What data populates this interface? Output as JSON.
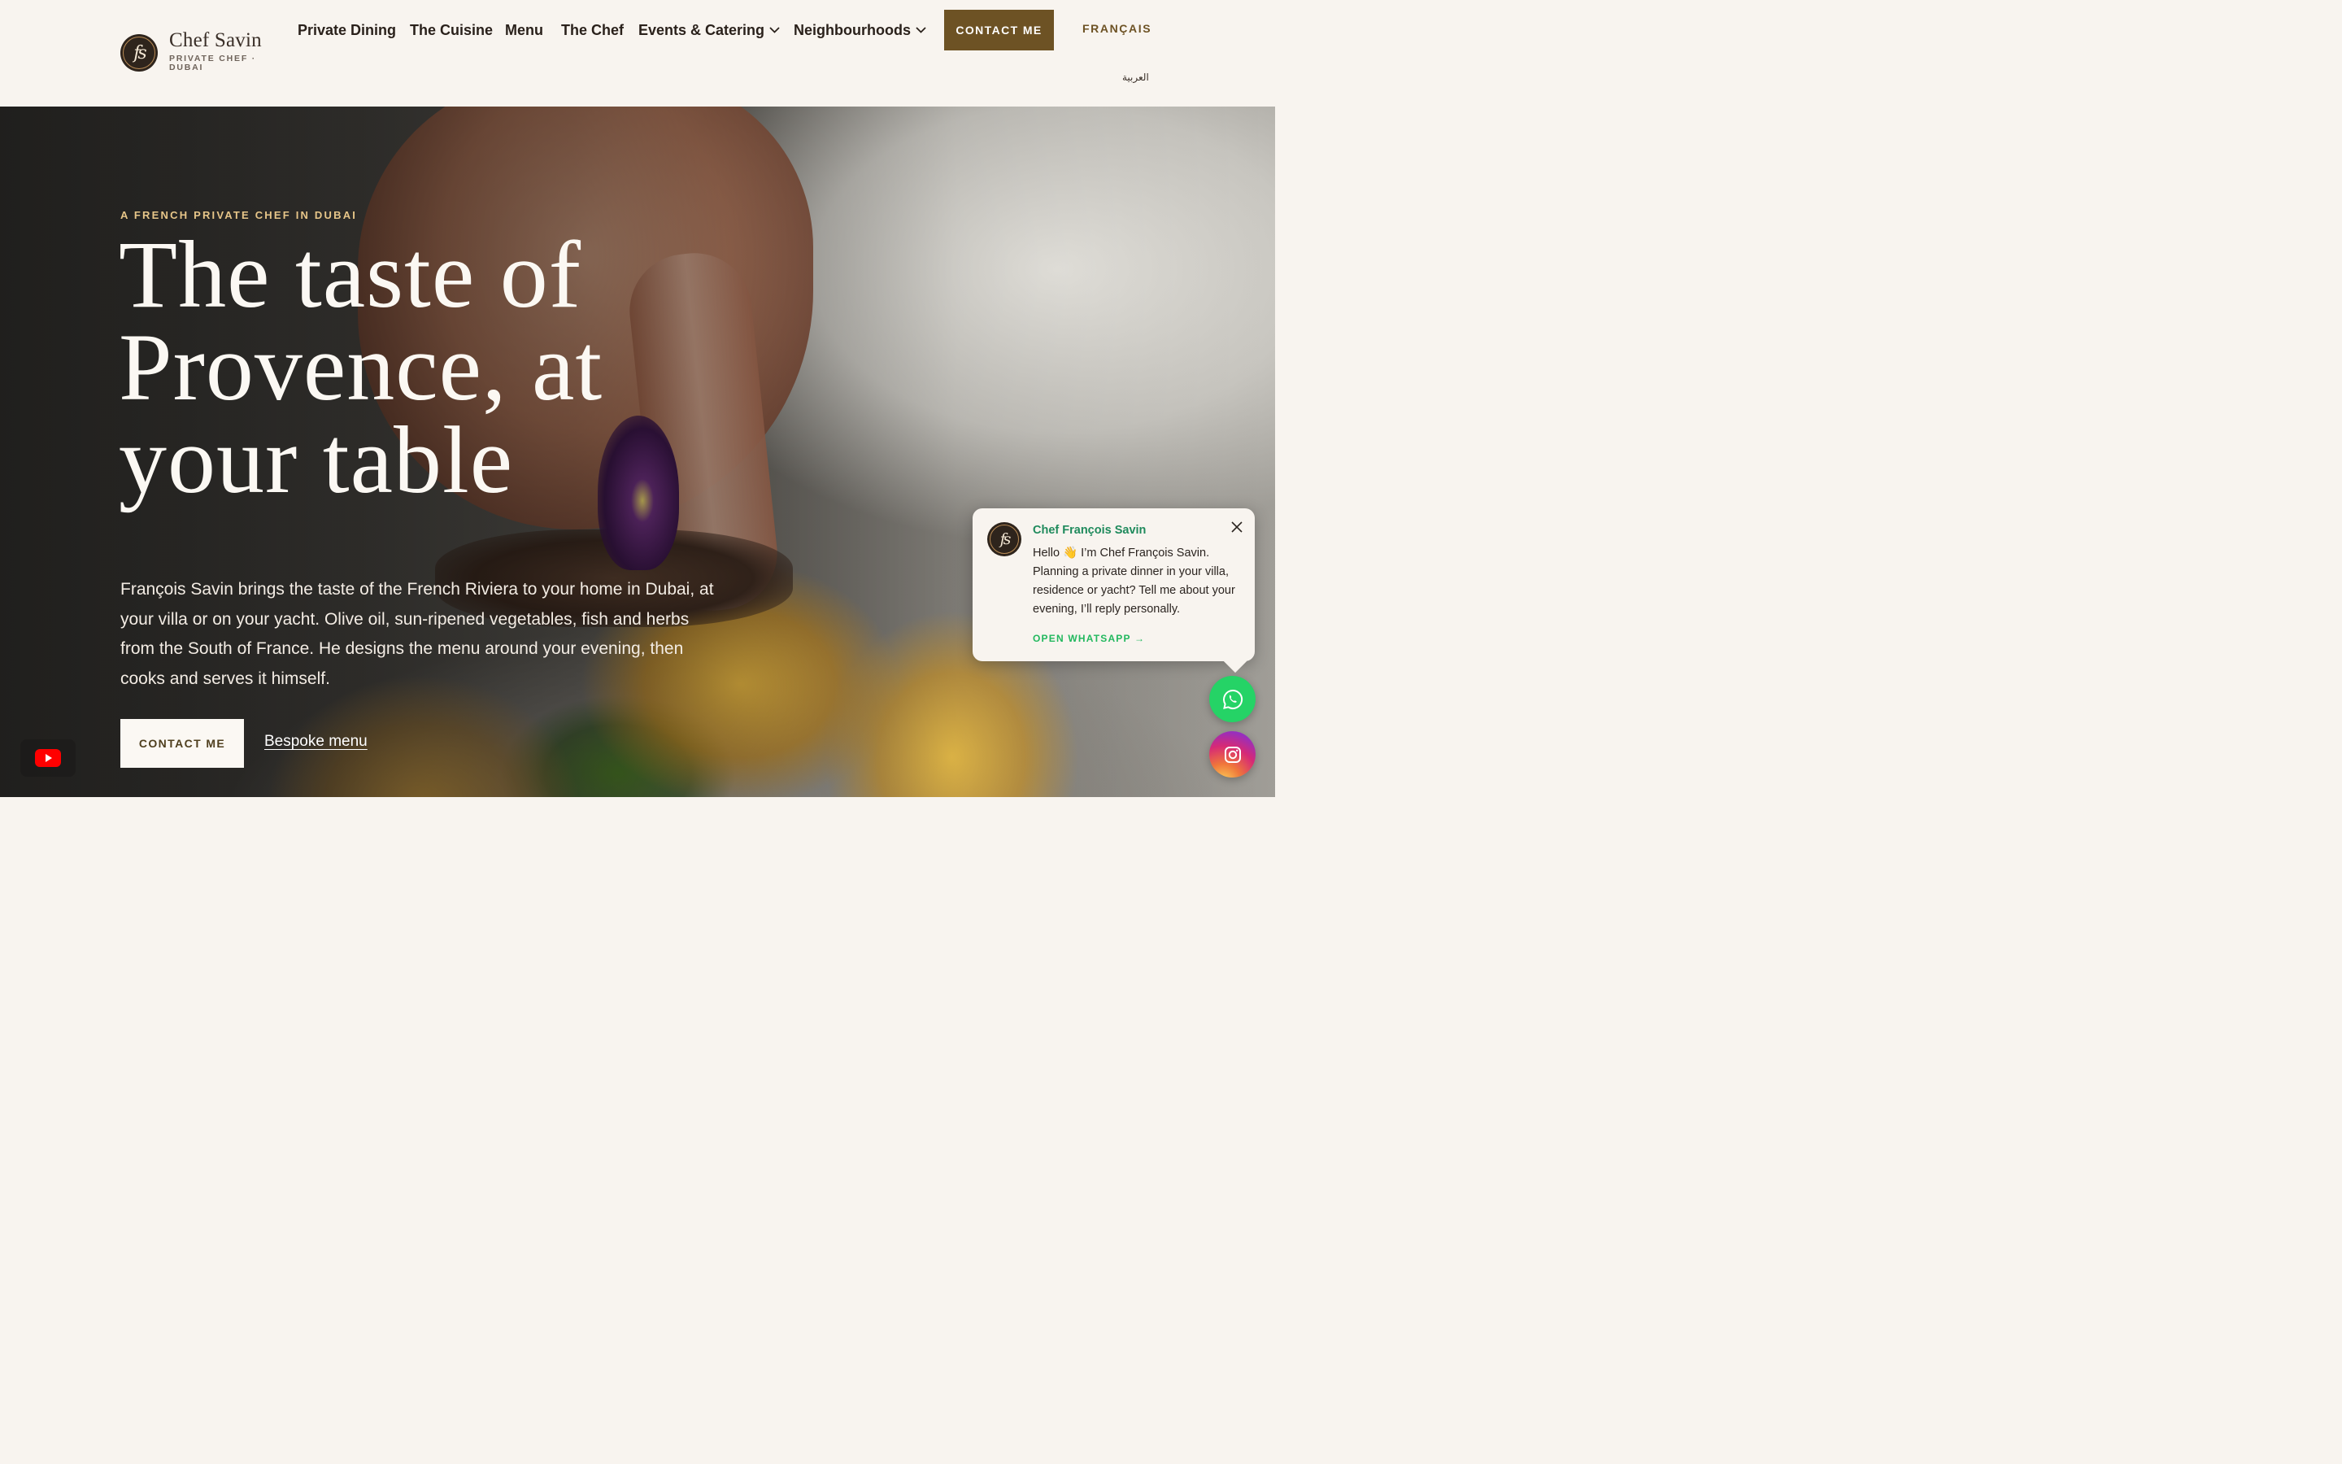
{
  "header": {
    "logo_monogram": "fs",
    "brand_name": "Chef Savin",
    "brand_sub": "PRIVATE CHEF · DUBAI",
    "nav": [
      {
        "label": "Private Dining"
      },
      {
        "label": "The Cuisine"
      },
      {
        "label": "Menu"
      },
      {
        "label": "The Chef"
      },
      {
        "label": "Events & Catering",
        "dropdown": true
      },
      {
        "label": "Neighbourhoods",
        "dropdown": true
      }
    ],
    "contact_label": "CONTACT ME",
    "lang_fr": "FRANÇAIS",
    "lang_ar": "العربية"
  },
  "hero": {
    "eyebrow": "A FRENCH PRIVATE CHEF IN DUBAI",
    "title": "The taste of Provence, at your table",
    "description": "François Savin brings the taste of the French Riviera to your home in Dubai, at your villa or on your yacht. Olive oil, sun-ripened vegetables, fish and herbs from the South of France. He designs the menu around your evening, then cooks and serves it himself.",
    "cta_label": "CONTACT ME",
    "link_label": "Bespoke menu"
  },
  "chat": {
    "avatar_monogram": "fs",
    "name": "Chef François Savin",
    "message": "Hello 👋 I’m Chef François Savin. Planning a private dinner in your villa, residence or yacht? Tell me about your evening, I’ll reply personally.",
    "link_label": "OPEN WHATSAPP →"
  },
  "floating": {
    "youtube_icon": "youtube-icon",
    "whatsapp_icon": "whatsapp-icon",
    "instagram_icon": "instagram-icon"
  },
  "colors": {
    "cream": "#f8f4ef",
    "brown_accent": "#6d5224",
    "gold_eyebrow": "#e7c689",
    "whatsapp_green": "#25d366",
    "chat_name_green": "#1f8a5c"
  }
}
